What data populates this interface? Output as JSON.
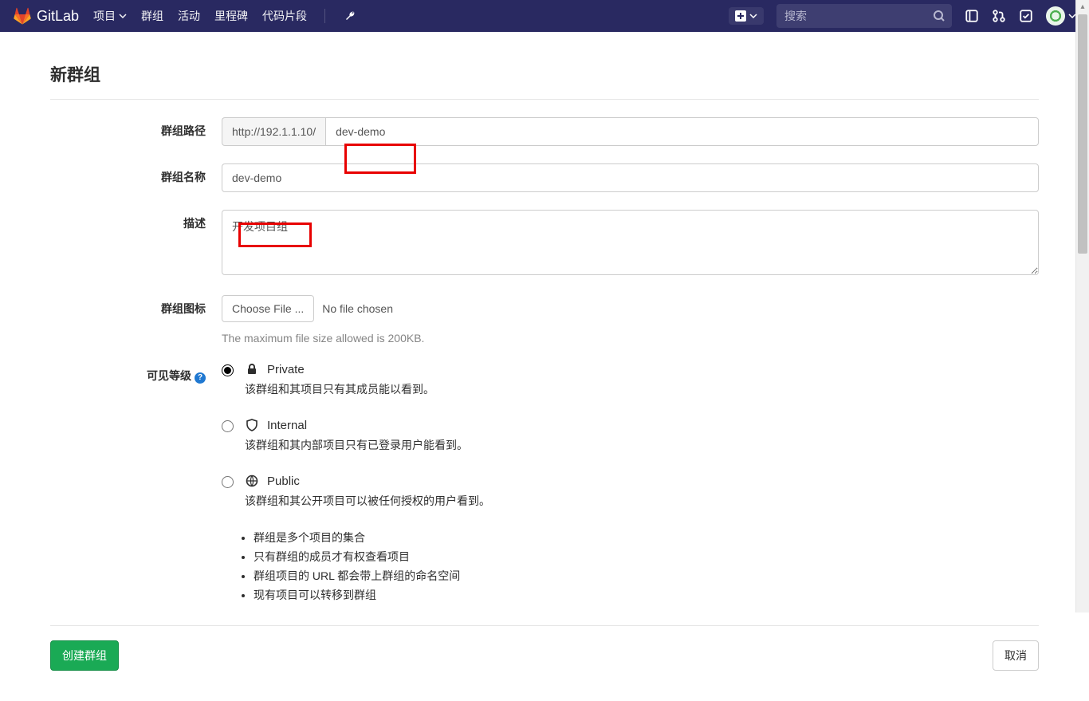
{
  "brand": "GitLab",
  "nav": {
    "projects": "项目",
    "groups": "群组",
    "activity": "活动",
    "milestones": "里程碑",
    "snippets": "代码片段"
  },
  "search_placeholder": "搜索",
  "page_title": "新群组",
  "labels": {
    "path": "群组路径",
    "name": "群组名称",
    "desc": "描述",
    "icon": "群组图标",
    "visibility": "可见等级"
  },
  "form": {
    "path_prefix": "http://192.1.1.10/",
    "path_value": "dev-demo",
    "name_value": "dev-demo",
    "desc_value": "开发项目组",
    "file_button": "Choose File ...",
    "file_status": "No file chosen",
    "file_hint": "The maximum file size allowed is 200KB."
  },
  "visibility": {
    "private": {
      "title": "Private",
      "desc": "该群组和其项目只有其成员能以看到。"
    },
    "internal": {
      "title": "Internal",
      "desc": "该群组和其内部项目只有已登录用户能看到。"
    },
    "public": {
      "title": "Public",
      "desc": "该群组和其公开项目可以被任何授权的用户看到。"
    }
  },
  "bullets": {
    "b1": "群组是多个项目的集合",
    "b2": "只有群组的成员才有权查看项目",
    "b3": "群组项目的 URL 都会带上群组的命名空间",
    "b4": "现有项目可以转移到群组"
  },
  "actions": {
    "create": "创建群组",
    "cancel": "取消"
  }
}
